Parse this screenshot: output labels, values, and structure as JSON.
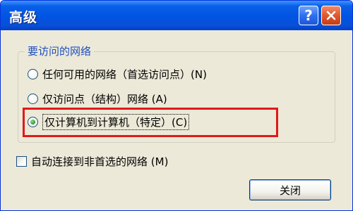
{
  "window": {
    "title": "高级",
    "help_label": "?",
    "close_icon": "close-x-icon"
  },
  "group": {
    "legend": "要访问的网络",
    "options": [
      {
        "label": "任何可用的网络（首选访问点）(N)",
        "checked": false
      },
      {
        "label": "仅访问点（结构）网络 (A)",
        "checked": false
      },
      {
        "label": "仅计算机到计算机（特定）(C)",
        "checked": true
      }
    ]
  },
  "auto_connect": {
    "label": "自动连接到非首选的网络 (M)",
    "checked": false
  },
  "buttons": {
    "close_label": "关闭"
  },
  "colors": {
    "titlebar": "#0054e3",
    "dialog_bg": "#ece9d8",
    "legend_text": "#1f4fbf",
    "highlight_border": "#e01919"
  }
}
